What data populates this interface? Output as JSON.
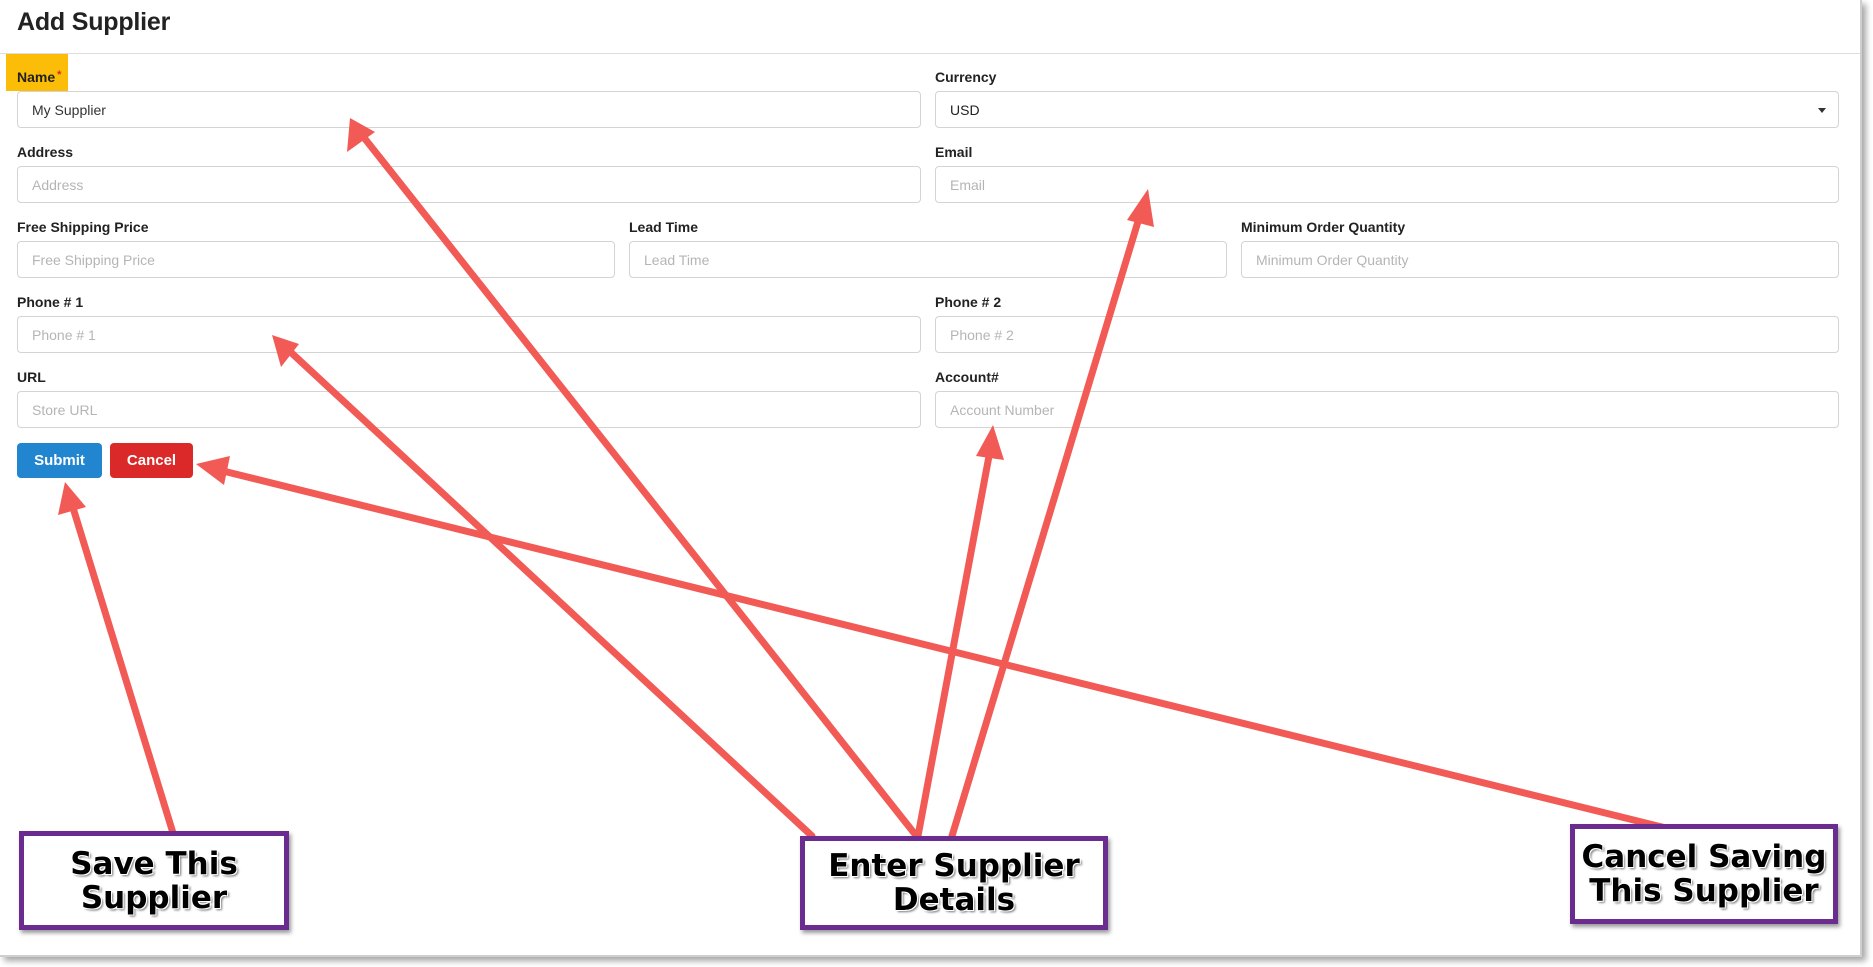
{
  "header": {
    "title": "Add Supplier"
  },
  "form": {
    "name": {
      "label": "Name",
      "required_mark": "*",
      "value": "My Supplier"
    },
    "currency": {
      "label": "Currency",
      "selected": "USD"
    },
    "address": {
      "label": "Address",
      "placeholder": "Address"
    },
    "email": {
      "label": "Email",
      "placeholder": "Email"
    },
    "free_shipping_price": {
      "label": "Free Shipping Price",
      "placeholder": "Free Shipping Price"
    },
    "lead_time": {
      "label": "Lead Time",
      "placeholder": "Lead Time"
    },
    "minimum_order_quantity": {
      "label": "Minimum Order Quantity",
      "placeholder": "Minimum Order Quantity"
    },
    "phone1": {
      "label": "Phone # 1",
      "placeholder": "Phone # 1"
    },
    "phone2": {
      "label": "Phone # 2",
      "placeholder": "Phone # 2"
    },
    "url": {
      "label": "URL",
      "placeholder": "Store URL"
    },
    "account": {
      "label": "Account#",
      "placeholder": "Account Number"
    }
  },
  "buttons": {
    "submit": "Submit",
    "cancel": "Cancel"
  },
  "callouts": {
    "save": [
      "Save This",
      "Supplier"
    ],
    "enter": [
      "Enter Supplier",
      "Details"
    ],
    "cancel": [
      "Cancel Saving",
      "This Supplier"
    ]
  },
  "colors": {
    "name_label_highlight": "#fbbd08",
    "submit": "#2185d0",
    "cancel": "#db2828",
    "arrow": "#f25a55",
    "callout_border": "#6b2c8f"
  }
}
